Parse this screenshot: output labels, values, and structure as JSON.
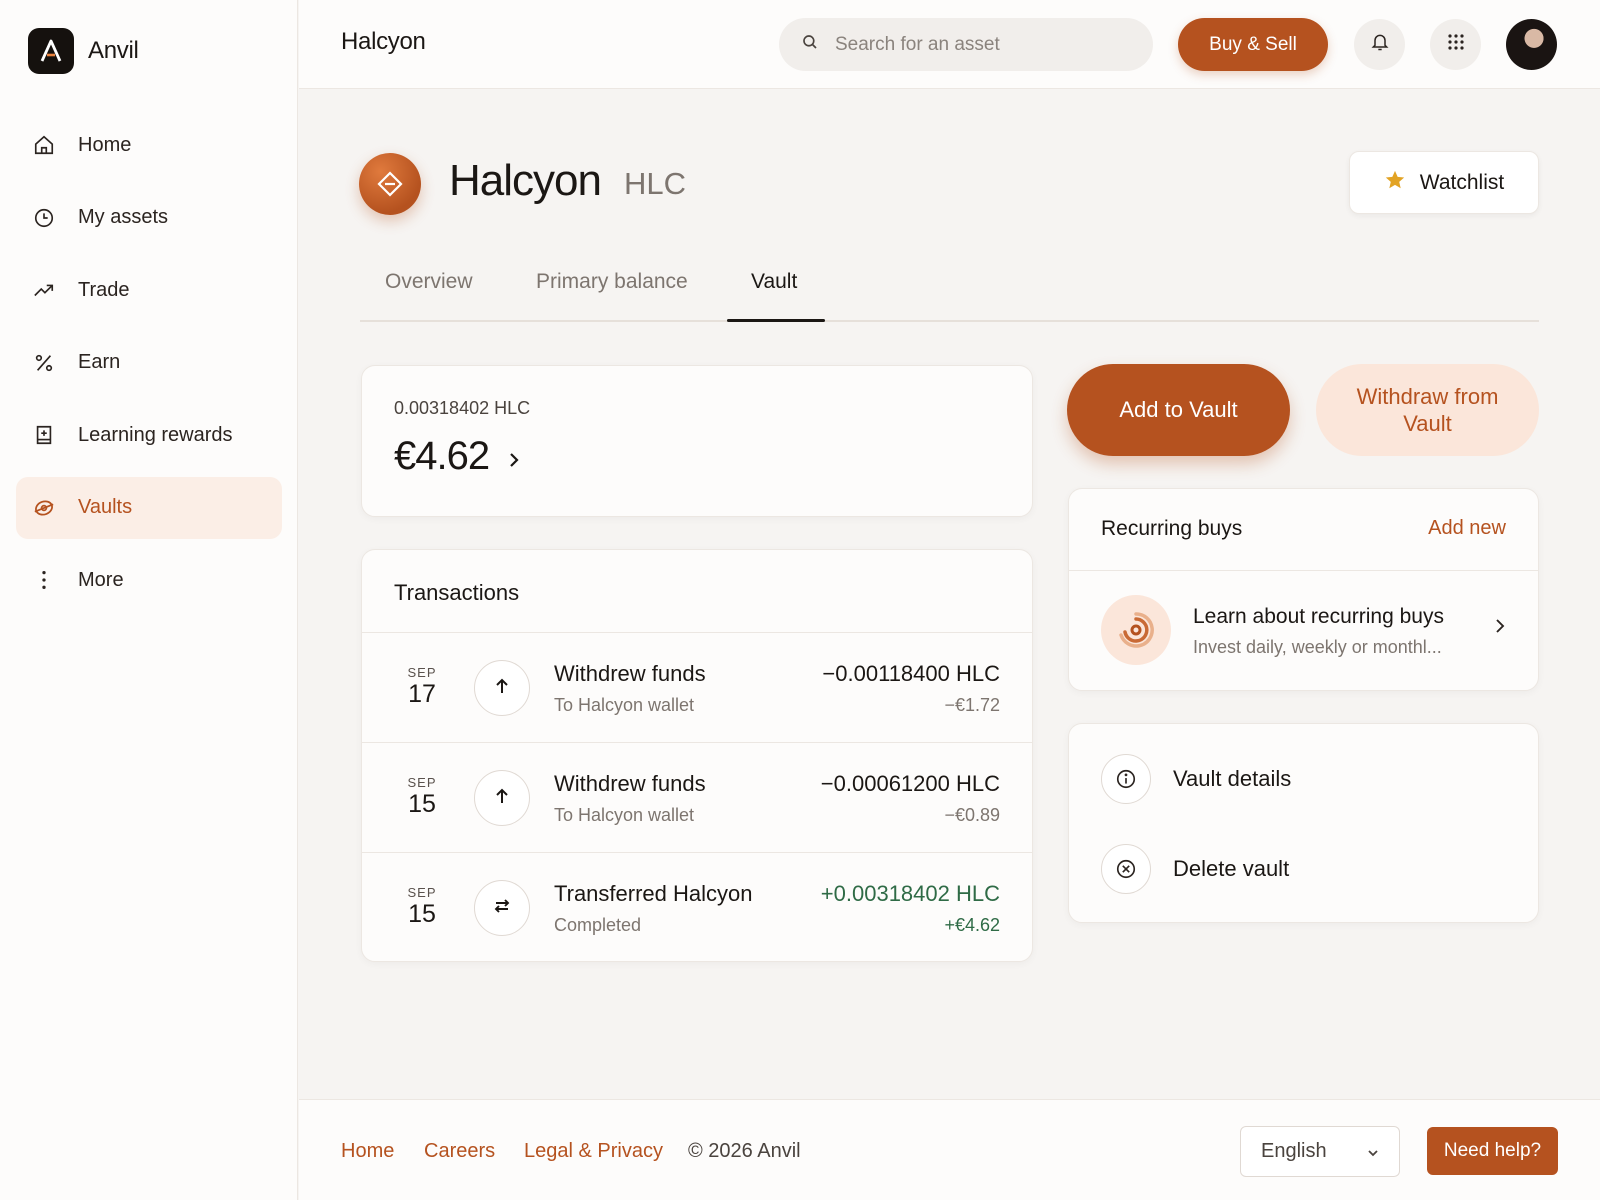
{
  "app": {
    "brand_name": "Anvil",
    "page_title": "Halcyon"
  },
  "sidebar": {
    "items": [
      {
        "label": "Home",
        "icon": "home-icon"
      },
      {
        "label": "My assets",
        "icon": "clock-icon"
      },
      {
        "label": "Trade",
        "icon": "trend-up-icon"
      },
      {
        "label": "Earn",
        "icon": "percent-icon"
      },
      {
        "label": "Learning rewards",
        "icon": "book-plus-icon"
      },
      {
        "label": "Vaults",
        "icon": "vault-icon",
        "active": true
      },
      {
        "label": "More",
        "icon": "more-vertical-icon"
      }
    ]
  },
  "topbar": {
    "search_placeholder": "Search for an asset",
    "buy_sell_label": "Buy & Sell"
  },
  "asset": {
    "name": "Halcyon",
    "ticker": "HLC",
    "watchlist_label": "Watchlist"
  },
  "tabs": [
    {
      "label": "Overview"
    },
    {
      "label": "Primary balance"
    },
    {
      "label": "Vault",
      "active": true
    }
  ],
  "balance": {
    "crypto_amount": "0.00318402 HLC",
    "fiat_amount": "€4.62"
  },
  "transactions": {
    "title": "Transactions",
    "rows": [
      {
        "month": "SEP",
        "day": "17",
        "title": "Withdrew funds",
        "subtitle": "To Halcyon wallet",
        "amount": "−0.00118400 HLC",
        "fiat": "−€1.72",
        "positive": false,
        "icon": "arrow-up-icon"
      },
      {
        "month": "SEP",
        "day": "15",
        "title": "Withdrew funds",
        "subtitle": "To Halcyon wallet",
        "amount": "−0.00061200 HLC",
        "fiat": "−€0.89",
        "positive": false,
        "icon": "arrow-up-icon"
      },
      {
        "month": "SEP",
        "day": "15",
        "title": "Transferred Halcyon",
        "subtitle": "Completed",
        "amount": "+0.00318402 HLC",
        "fiat": "+€4.62",
        "positive": true,
        "icon": "transfer-icon"
      }
    ]
  },
  "actions": {
    "add_label": "Add to Vault",
    "withdraw_label": "Withdraw from Vault"
  },
  "recurring": {
    "title": "Recurring buys",
    "add_new_label": "Add new",
    "learn_title": "Learn about recurring buys",
    "learn_desc": "Invest daily, weekly or monthl..."
  },
  "vault_menu": {
    "details_label": "Vault details",
    "delete_label": "Delete vault"
  },
  "footer": {
    "links": [
      "Home",
      "Careers",
      "Legal & Privacy"
    ],
    "copyright": "© 2026 Anvil",
    "language": "English",
    "help_label": "Need help?"
  },
  "colors": {
    "accent": "#b5521f",
    "accent_soft": "#fbe6da",
    "positive": "#2f6b46"
  }
}
